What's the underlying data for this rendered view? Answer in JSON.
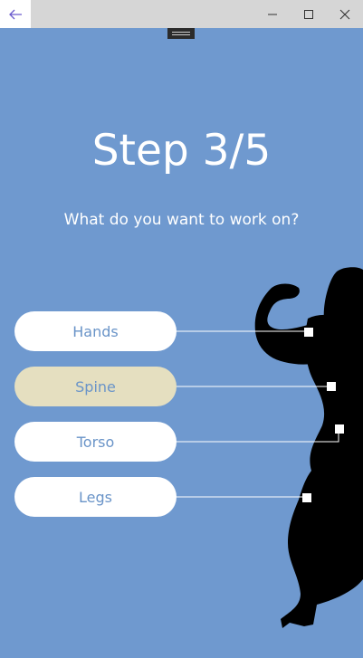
{
  "window": {
    "back_icon": "arrow-left-icon",
    "minimize_icon": "minimize-icon",
    "maximize_icon": "maximize-icon",
    "close_icon": "close-icon",
    "accent_color": "#6f99cf"
  },
  "main": {
    "title": "Step 3/5",
    "question": "What do you want to work on?",
    "options": [
      {
        "label": "Hands",
        "selected": false
      },
      {
        "label": "Spine",
        "selected": true
      },
      {
        "label": "Torso",
        "selected": false
      },
      {
        "label": "Legs",
        "selected": false
      }
    ],
    "selected_color": "#e5dfc0"
  }
}
